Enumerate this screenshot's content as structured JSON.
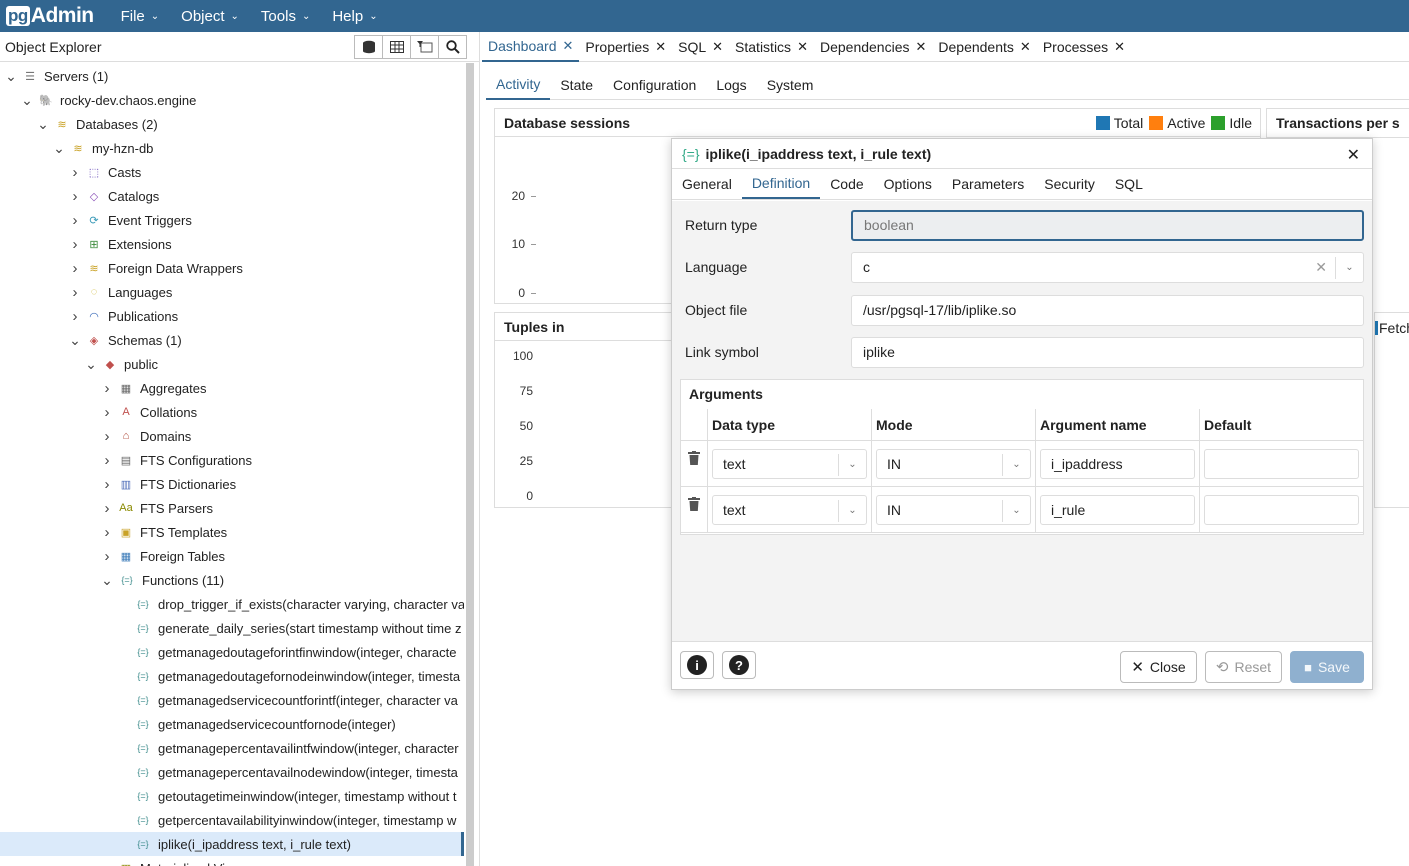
{
  "app": {
    "logo_pg": "pg",
    "logo_admin": "Admin"
  },
  "menu": [
    {
      "label": "File"
    },
    {
      "label": "Object"
    },
    {
      "label": "Tools"
    },
    {
      "label": "Help"
    }
  ],
  "object_explorer": {
    "title": "Object Explorer",
    "tree": [
      {
        "label": "Servers (1)",
        "level": 0,
        "toggle": "open",
        "icon": "servers-icon"
      },
      {
        "label": "rocky-dev.chaos.engine",
        "level": 1,
        "toggle": "open",
        "icon": "elephant-icon"
      },
      {
        "label": "Databases (2)",
        "level": 2,
        "toggle": "open",
        "icon": "databases-icon"
      },
      {
        "label": "my-hzn-db",
        "level": 3,
        "toggle": "open",
        "icon": "database-icon"
      },
      {
        "label": "Casts",
        "level": 4,
        "toggle": "closed",
        "icon": "casts-icon"
      },
      {
        "label": "Catalogs",
        "level": 4,
        "toggle": "closed",
        "icon": "catalogs-icon"
      },
      {
        "label": "Event Triggers",
        "level": 4,
        "toggle": "closed",
        "icon": "event-triggers-icon"
      },
      {
        "label": "Extensions",
        "level": 4,
        "toggle": "closed",
        "icon": "extensions-icon"
      },
      {
        "label": "Foreign Data Wrappers",
        "level": 4,
        "toggle": "closed",
        "icon": "fdw-icon"
      },
      {
        "label": "Languages",
        "level": 4,
        "toggle": "closed",
        "icon": "languages-icon"
      },
      {
        "label": "Publications",
        "level": 4,
        "toggle": "closed",
        "icon": "publications-icon"
      },
      {
        "label": "Schemas (1)",
        "level": 4,
        "toggle": "open",
        "icon": "schemas-icon"
      },
      {
        "label": "public",
        "level": 5,
        "toggle": "open",
        "icon": "schema-icon"
      },
      {
        "label": "Aggregates",
        "level": 6,
        "toggle": "closed",
        "icon": "aggregates-icon"
      },
      {
        "label": "Collations",
        "level": 6,
        "toggle": "closed",
        "icon": "collations-icon"
      },
      {
        "label": "Domains",
        "level": 6,
        "toggle": "closed",
        "icon": "domains-icon"
      },
      {
        "label": "FTS Configurations",
        "level": 6,
        "toggle": "closed",
        "icon": "fts-config-icon"
      },
      {
        "label": "FTS Dictionaries",
        "level": 6,
        "toggle": "closed",
        "icon": "fts-dict-icon"
      },
      {
        "label": "FTS Parsers",
        "level": 6,
        "toggle": "closed",
        "icon": "fts-parser-icon"
      },
      {
        "label": "FTS Templates",
        "level": 6,
        "toggle": "closed",
        "icon": "fts-template-icon"
      },
      {
        "label": "Foreign Tables",
        "level": 6,
        "toggle": "closed",
        "icon": "foreign-tables-icon"
      },
      {
        "label": "Functions (11)",
        "level": 6,
        "toggle": "open",
        "icon": "functions-icon"
      },
      {
        "label": "drop_trigger_if_exists(character varying, character va",
        "level": 7,
        "toggle": "none",
        "icon": "function-icon"
      },
      {
        "label": "generate_daily_series(start timestamp without time z",
        "level": 7,
        "toggle": "none",
        "icon": "function-icon"
      },
      {
        "label": "getmanagedoutageforintfinwindow(integer, characte",
        "level": 7,
        "toggle": "none",
        "icon": "function-icon"
      },
      {
        "label": "getmanagedoutagefornodeinwindow(integer, timesta",
        "level": 7,
        "toggle": "none",
        "icon": "function-icon"
      },
      {
        "label": "getmanagedservicecountforintf(integer, character va",
        "level": 7,
        "toggle": "none",
        "icon": "function-icon"
      },
      {
        "label": "getmanagedservicecountfornode(integer)",
        "level": 7,
        "toggle": "none",
        "icon": "function-icon"
      },
      {
        "label": "getmanagepercentavailintfwindow(integer, character",
        "level": 7,
        "toggle": "none",
        "icon": "function-icon"
      },
      {
        "label": "getmanagepercentavailnodewindow(integer, timesta",
        "level": 7,
        "toggle": "none",
        "icon": "function-icon"
      },
      {
        "label": "getoutagetimeinwindow(integer, timestamp without t",
        "level": 7,
        "toggle": "none",
        "icon": "function-icon"
      },
      {
        "label": "getpercentavailabilityinwindow(integer, timestamp w",
        "level": 7,
        "toggle": "none",
        "icon": "function-icon"
      },
      {
        "label": "iplike(i_ipaddress text, i_rule text)",
        "level": 7,
        "toggle": "none",
        "icon": "function-icon",
        "selected": true
      },
      {
        "label": "Materialized Views",
        "level": 6,
        "toggle": "closed",
        "icon": "mviews-icon"
      }
    ]
  },
  "main_tabs": [
    {
      "label": "Dashboard",
      "active": true
    },
    {
      "label": "Properties"
    },
    {
      "label": "SQL"
    },
    {
      "label": "Statistics"
    },
    {
      "label": "Dependencies"
    },
    {
      "label": "Dependents"
    },
    {
      "label": "Processes"
    }
  ],
  "sub_tabs": [
    {
      "label": "Activity",
      "active": true
    },
    {
      "label": "State"
    },
    {
      "label": "Configuration"
    },
    {
      "label": "Logs"
    },
    {
      "label": "System"
    }
  ],
  "dashboard": {
    "sessions_title": "Database sessions",
    "legend": [
      {
        "label": "Total",
        "color": "#1f77b4"
      },
      {
        "label": "Active",
        "color": "#ff7f0e"
      },
      {
        "label": "Idle",
        "color": "#2ca02c"
      }
    ],
    "sessions_ticks": [
      "20",
      "10",
      "0"
    ],
    "transactions_title": "Transactions per s",
    "tuples_title": "Tuples in",
    "tuples_ticks": [
      "100",
      "75",
      "50",
      "25",
      "0"
    ],
    "fetch_label": "Fetch"
  },
  "dialog": {
    "title": "iplike(i_ipaddress text, i_rule text)",
    "tabs": [
      {
        "label": "General"
      },
      {
        "label": "Definition",
        "active": true
      },
      {
        "label": "Code"
      },
      {
        "label": "Options"
      },
      {
        "label": "Parameters"
      },
      {
        "label": "Security"
      },
      {
        "label": "SQL"
      }
    ],
    "fields": {
      "return_type": {
        "label": "Return type",
        "value": "boolean"
      },
      "language": {
        "label": "Language",
        "value": "c"
      },
      "object_file": {
        "label": "Object file",
        "value": "/usr/pgsql-17/lib/iplike.so"
      },
      "link_symbol": {
        "label": "Link symbol",
        "value": "iplike"
      }
    },
    "arguments": {
      "title": "Arguments",
      "columns": [
        "Data type",
        "Mode",
        "Argument name",
        "Default"
      ],
      "rows": [
        {
          "data_type": "text",
          "mode": "IN",
          "name": "i_ipaddress",
          "default": ""
        },
        {
          "data_type": "text",
          "mode": "IN",
          "name": "i_rule",
          "default": ""
        }
      ]
    },
    "footer": {
      "close": "Close",
      "reset": "Reset",
      "save": "Save"
    }
  }
}
